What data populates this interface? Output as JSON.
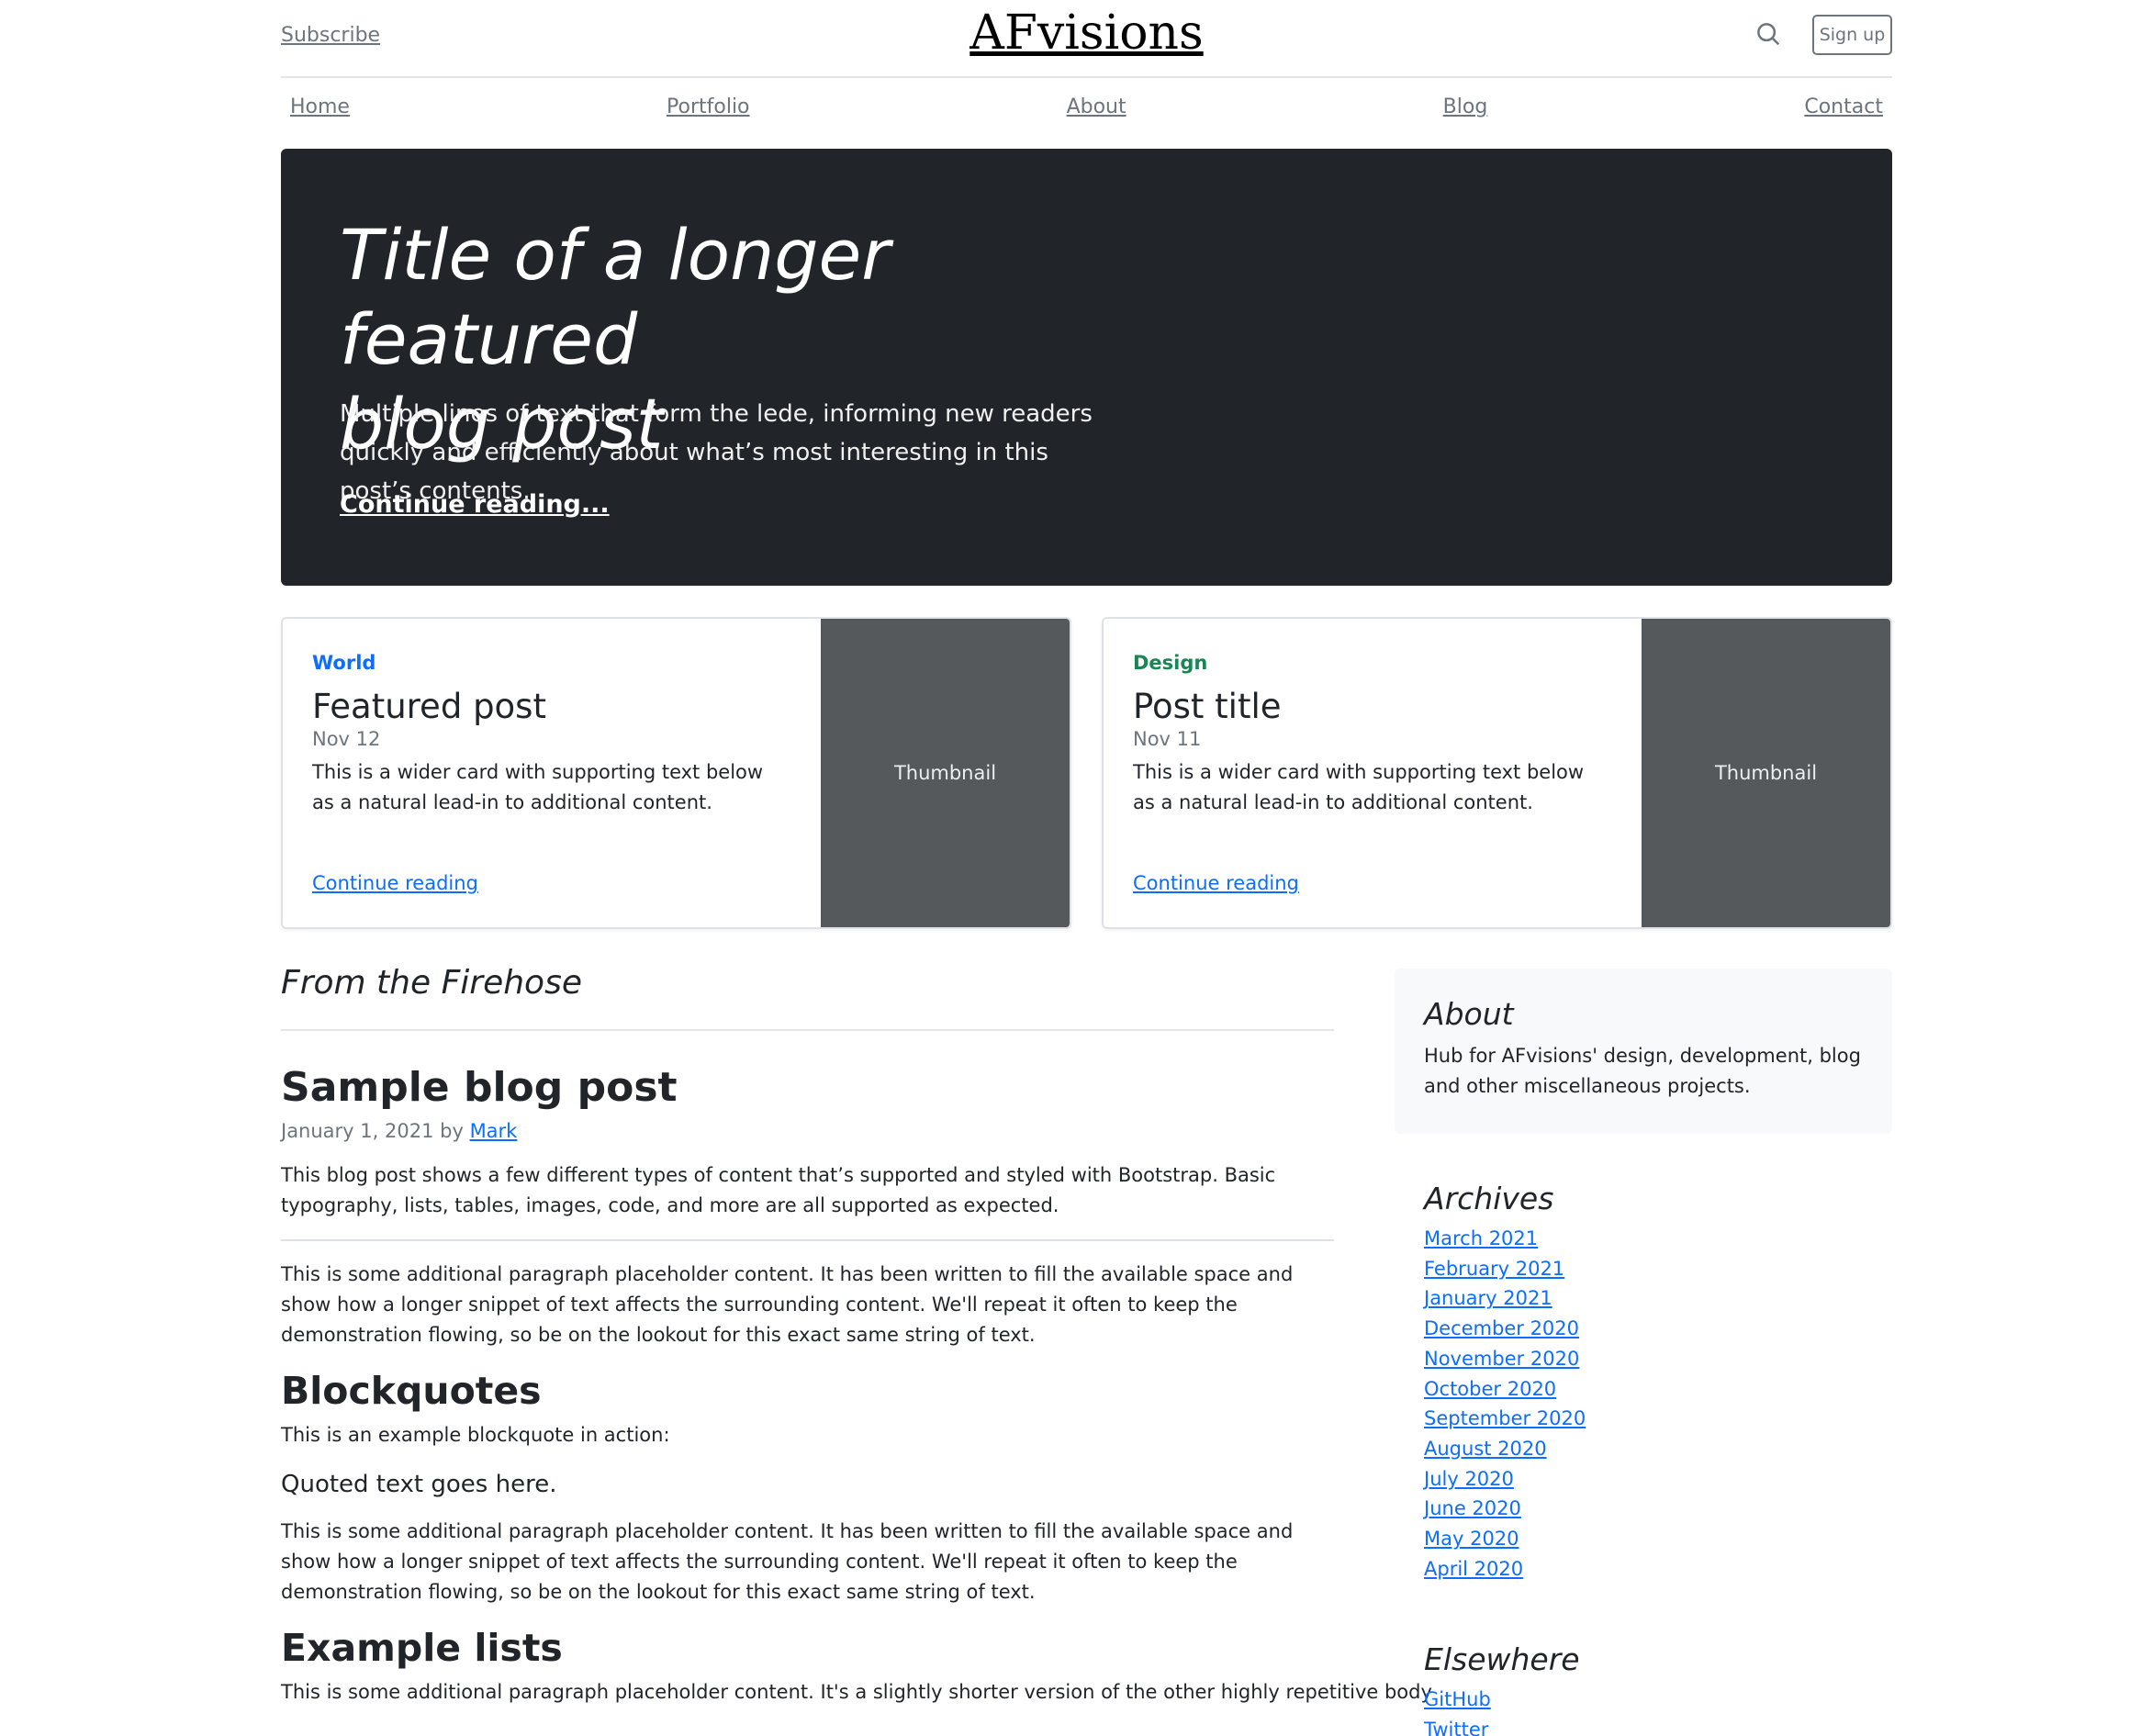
{
  "header": {
    "subscribe": "Subscribe",
    "brand": "AFvisions",
    "search_icon": "search-icon",
    "signup": "Sign up"
  },
  "nav": [
    "Home",
    "Portfolio",
    "About",
    "Blog",
    "Contact"
  ],
  "hero": {
    "title_line1": "Title of a longer featured",
    "title_line2": "blog post",
    "lede": "Multiple lines of text that form the lede, informing new readers quickly and efficiently about what’s most interesting in this post’s contents.",
    "link": "Continue reading..."
  },
  "cards": [
    {
      "category": "World",
      "category_color": "#0d6efd",
      "title": "Featured post",
      "date": "Nov 12",
      "text": "This is a wider card with supporting text below as a natural lead-in to additional content.",
      "link": "Continue reading",
      "thumb": "Thumbnail"
    },
    {
      "category": "Design",
      "category_color": "#198754",
      "title": "Post title",
      "date": "Nov 11",
      "text": "This is a wider card with supporting text below as a natural lead-in to additional content.",
      "link": "Continue reading",
      "thumb": "Thumbnail"
    }
  ],
  "main": {
    "section_title": "From the Firehose",
    "post_title": "Sample blog post",
    "post_date": "January 1, 2021 by",
    "post_author": "Mark",
    "intro": "This blog post shows a few different types of content that’s supported and styled with Bootstrap. Basic typography, lists, tables, images, code, and more are all supported as expected.",
    "para1": "This is some additional paragraph placeholder content. It has been written to fill the available space and show how a longer snippet of text affects the surrounding content. We'll repeat it often to keep the demonstration flowing, so be on the lookout for this exact same string of text.",
    "h_blockquotes": "Blockquotes",
    "bq_intro": "This is an example blockquote in action:",
    "quote": "Quoted text goes here.",
    "para2": "This is some additional paragraph placeholder content. It has been written to fill the available space and show how a longer snippet of text affects the surrounding content. We'll repeat it often to keep the demonstration flowing, so be on the lookout for this exact same string of text.",
    "h_lists": "Example lists",
    "para3": "This is some additional paragraph placeholder content. It's a slightly shorter version of the other highly repetitive body"
  },
  "sidebar": {
    "about_title": "About",
    "about_text": "Hub for AFvisions' design, development, blog and other miscellaneous projects.",
    "archives_title": "Archives",
    "archives": [
      "March 2021",
      "February 2021",
      "January 2021",
      "December 2020",
      "November 2020",
      "October 2020",
      "September 2020",
      "August 2020",
      "July 2020",
      "June 2020",
      "May 2020",
      "April 2020"
    ],
    "elsewhere_title": "Elsewhere",
    "elsewhere": [
      "GitHub",
      "Twitter"
    ]
  }
}
